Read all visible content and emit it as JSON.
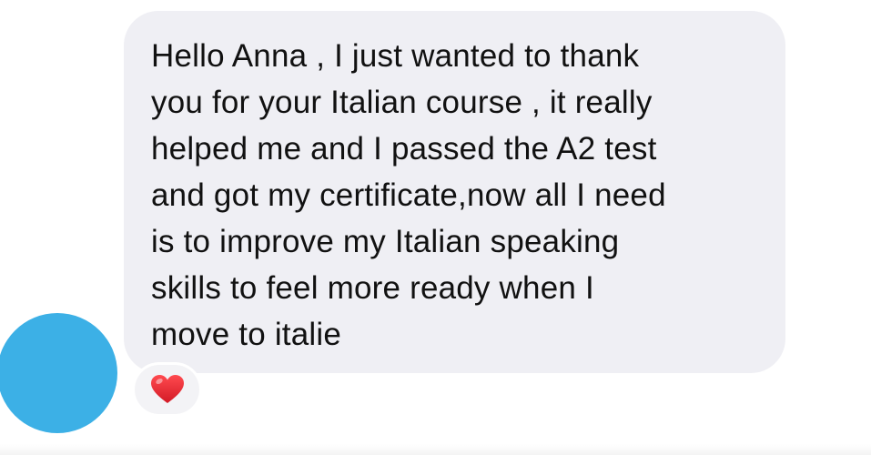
{
  "message": {
    "text": "Hello Anna , I just wanted to thank\nyou for your Italian course , it really\nhelped me and I passed the A2 test\nand got my certificate,now all I need\nis to improve my Italian speaking\nskills to feel more ready when I\nmove to italie"
  },
  "reaction": {
    "emoji_name": "red-heart",
    "color": "#e0242e"
  },
  "colors": {
    "avatar": "#3cb0e6",
    "bubble": "#efeff4",
    "text": "#111111"
  }
}
